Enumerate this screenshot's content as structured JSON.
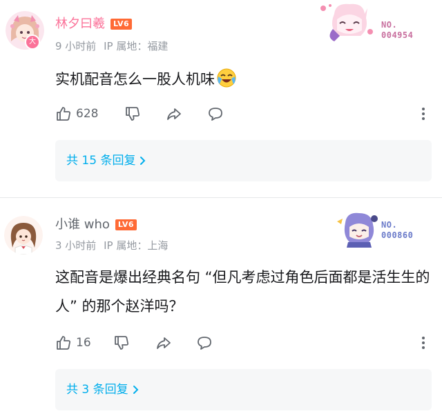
{
  "comments": [
    {
      "username": "林夕曰羲",
      "level": "LV6",
      "avatar_badge": "大",
      "time": "9 小时前",
      "ip_location": "IP 属地：福建",
      "text": "实机配音怎么一股人机味",
      "emoji": "laughing-crying-emoji",
      "like_count": "628",
      "reply_summary": "共 15 条回复",
      "fan_badge": {
        "line1": "NO.",
        "line2": "004954"
      },
      "colors": {
        "username": "#fb7299",
        "fan_badge": "#c86f9e"
      }
    },
    {
      "username": "小谁 who",
      "level": "LV6",
      "time": "3 小时前",
      "ip_location": "IP 属地：上海",
      "text": "这配音是爆出经典名句 “但凡考虑过角色后面都是活生生的人” 的那个赵洋吗？",
      "like_count": "16",
      "reply_summary": "共 3 条回复",
      "fan_badge": {
        "line1": "NO.",
        "line2": "000860"
      },
      "colors": {
        "username": "#61666d",
        "fan_badge": "#6a7ac9"
      }
    }
  ],
  "icons": {
    "like": "thumbs-up-icon",
    "dislike": "thumbs-down-icon",
    "share": "share-icon",
    "reply": "comment-bubble-icon",
    "more": "more-vertical-icon",
    "chevron": "chevron-right-icon"
  },
  "colors": {
    "level_tag": "#ff6a35",
    "link": "#00aeec",
    "meta_text": "#9499a0",
    "reply_box_bg": "#f6f7f8"
  }
}
